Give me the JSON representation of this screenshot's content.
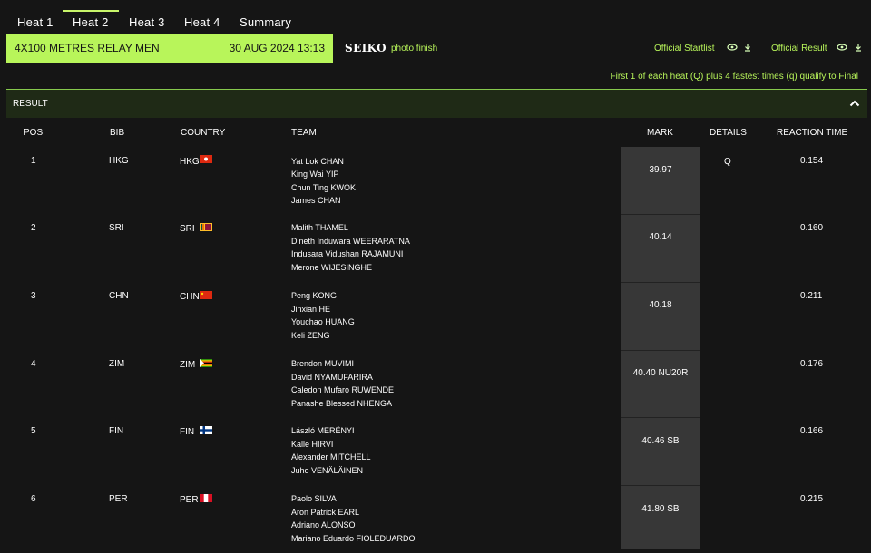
{
  "tabs": [
    {
      "label": "Heat 1"
    },
    {
      "label": "Heat 2"
    },
    {
      "label": "Heat 3"
    },
    {
      "label": "Heat 4"
    },
    {
      "label": "Summary"
    }
  ],
  "active_tab_index": 1,
  "event": {
    "name": "4X100 METRES RELAY MEN",
    "datetime": "30 AUG 2024 13:13"
  },
  "sponsor": {
    "brand": "SEIKO",
    "label": "photo finish"
  },
  "links": {
    "startlist": "Official Startlist",
    "result": "Official Result"
  },
  "qualify_note": "First 1 of each heat (Q) plus 4 fastest times (q) qualify to Final",
  "section_title": "RESULT",
  "columns": {
    "pos": "POS",
    "bib": "BIB",
    "country": "COUNTRY",
    "team": "TEAM",
    "mark": "MARK",
    "details": "DETAILS",
    "reaction": "REACTION TIME"
  },
  "colors": {
    "accent": "#b8f55a",
    "background": "#151515",
    "mark_column": "#373737",
    "section_bar": "#1f2a16"
  },
  "icons": [
    "eye-icon",
    "download-icon",
    "chevron-up-icon"
  ],
  "rows": [
    {
      "pos": "1",
      "bib": "HKG",
      "country": "HKG",
      "flag": "hong-kong-flag",
      "team": [
        "Yat Lok CHAN",
        "King Wai YIP",
        "Chun Ting KWOK",
        "James CHAN"
      ],
      "mark": "39.97",
      "details": "Q",
      "reaction": "0.154"
    },
    {
      "pos": "2",
      "bib": "SRI",
      "country": "SRI",
      "flag": "sri-lanka-flag",
      "team": [
        "Malith THAMEL",
        "Dineth Induwara WEERARATNA",
        "Indusara Vidushan RAJAMUNI",
        "Merone WIJESINGHE"
      ],
      "mark": "40.14",
      "details": "",
      "reaction": "0.160"
    },
    {
      "pos": "3",
      "bib": "CHN",
      "country": "CHN",
      "flag": "china-flag",
      "team": [
        "Peng KONG",
        "Jinxian HE",
        "Youchao HUANG",
        "Keli ZENG"
      ],
      "mark": "40.18",
      "details": "",
      "reaction": "0.211"
    },
    {
      "pos": "4",
      "bib": "ZIM",
      "country": "ZIM",
      "flag": "zimbabwe-flag",
      "team": [
        "Brendon MUVIMI",
        "David NYAMUFARIRA",
        "Caledon Mufaro RUWENDE",
        "Panashe Blessed NHENGA"
      ],
      "mark": "40.40 NU20R",
      "details": "",
      "reaction": "0.176"
    },
    {
      "pos": "5",
      "bib": "FIN",
      "country": "FIN",
      "flag": "finland-flag",
      "team": [
        "László MERÉNYI",
        "Kalle HIRVI",
        "Alexander MITCHELL",
        "Juho VENÄLÄINEN"
      ],
      "mark": "40.46 SB",
      "details": "",
      "reaction": "0.166"
    },
    {
      "pos": "6",
      "bib": "PER",
      "country": "PER",
      "flag": "peru-flag",
      "team": [
        "Paolo SILVA",
        "Aron Patrick EARL",
        "Adriano ALONSO",
        "Mariano Eduardo FIOLEDUARDO"
      ],
      "mark": "41.80 SB",
      "details": "",
      "reaction": "0.215"
    }
  ]
}
